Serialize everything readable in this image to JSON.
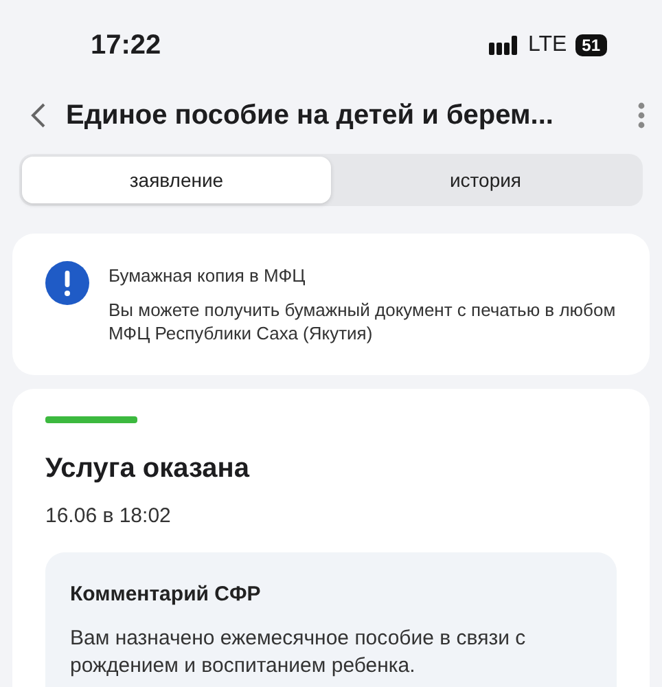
{
  "status_bar": {
    "time": "17:22",
    "network": "LTE",
    "battery": "51"
  },
  "header": {
    "title": "Единое пособие на детей и берем..."
  },
  "tabs": [
    {
      "label": "заявление",
      "selected": true
    },
    {
      "label": "история",
      "selected": false
    }
  ],
  "notice": {
    "title": "Бумажная копия в МФЦ",
    "text": "Вы можете получить бумажный документ с печатью в любом МФЦ Республики Саха (Якутия)"
  },
  "status": {
    "color": "#3cb93f",
    "title": "Услуга оказана",
    "date": "16.06 в 18:02",
    "comment": {
      "title": "Комментарий СФР",
      "text": "Вам назначено ежемесячное пособие в связи с рождением и воспитанием ребенка."
    }
  }
}
